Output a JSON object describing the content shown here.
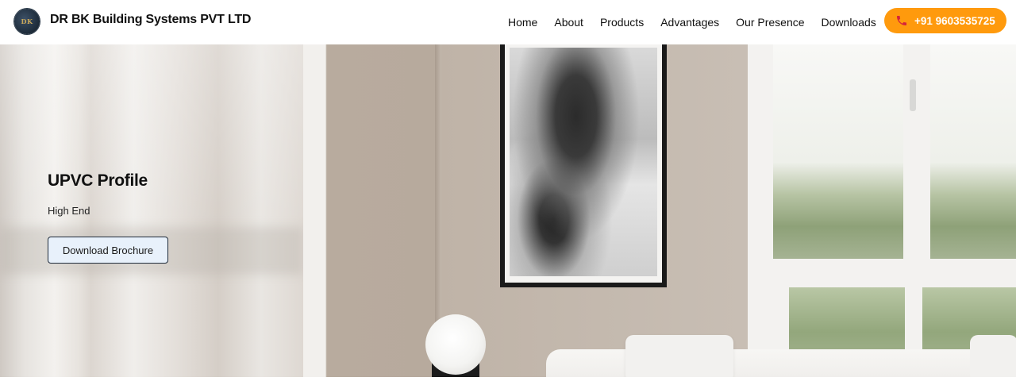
{
  "navbar": {
    "brand": "DR BK Building Systems PVT LTD",
    "logo_text": "DK",
    "links": [
      "Home",
      "About",
      "Products",
      "Advantages",
      "Our Presence",
      "Downloads"
    ],
    "call_label": "+91 9603535725",
    "call_icon": "phone-icon",
    "accent": "#ff9a0d"
  },
  "hero": {
    "title": "UPVC Profile",
    "subtitle": "High End",
    "button_label": "Download Brochure",
    "button_bg": "#e8f1fb"
  }
}
